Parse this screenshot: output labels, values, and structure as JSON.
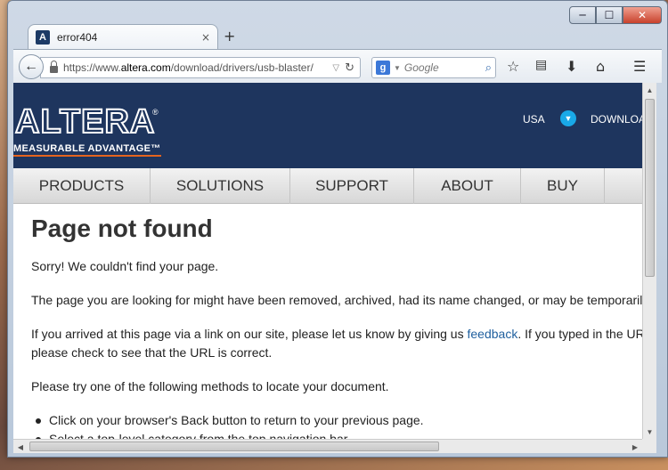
{
  "browser": {
    "tab_title": "error404",
    "tab_favicon_letter": "A",
    "tab_close": "×",
    "new_tab": "+",
    "url_prefix": "https://www.",
    "url_domain": "altera.com",
    "url_path": "/download/drivers/usb-blaster/",
    "search_placeholder": "Google",
    "search_engine_icon": "g-icon"
  },
  "header": {
    "logo_word": "ALTERA",
    "logo_reg": "®",
    "logo_tagline": "MEASURABLE ADVANTAGE™",
    "region": "USA",
    "download_link": "DOWNLOADS"
  },
  "nav": {
    "items": [
      "PRODUCTS",
      "SOLUTIONS",
      "SUPPORT",
      "ABOUT",
      "BUY"
    ]
  },
  "content": {
    "title": "Page not found",
    "p1": "Sorry! We couldn't find your page.",
    "p2": "The page you are looking for might have been removed, archived, had its name changed, or may be temporarily unavailable.",
    "p3_before": "If you arrived at this page via a link on our site, please let us know by giving us ",
    "p3_link": "feedback",
    "p3_after": ". If you typed in the URL,",
    "p3_line2": "please check to see that the URL is correct.",
    "p4": "Please try one of the following methods to locate your document.",
    "bullets": [
      "Click on your browser's Back button to return to your previous page.",
      "Select a top-level category from the top navigation bar."
    ]
  },
  "colors": {
    "header_bg": "#1e355e",
    "link": "#1f5f9e",
    "logo_underline": "#e5641e",
    "region_dropdown": "#19a9e8"
  }
}
